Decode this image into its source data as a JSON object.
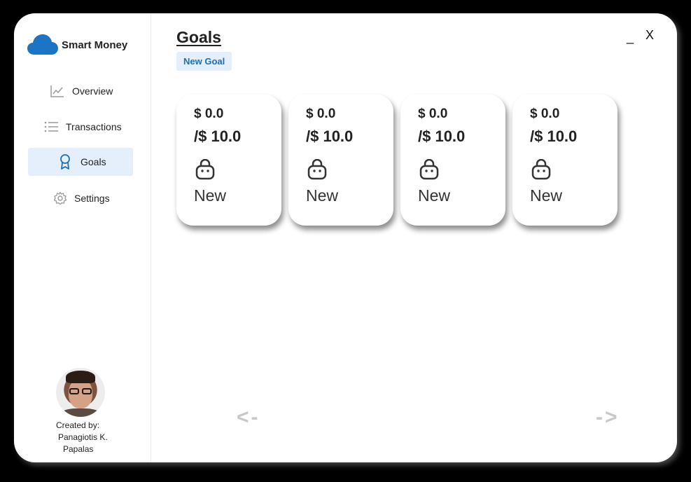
{
  "app": {
    "name": "Smart Money"
  },
  "window_controls": {
    "minimize_label": "_",
    "close_label": "X"
  },
  "sidebar": {
    "items": [
      {
        "label": "Overview",
        "icon": "chart-line-icon",
        "active": false
      },
      {
        "label": "Transactions",
        "icon": "list-icon",
        "active": false
      },
      {
        "label": "Goals",
        "icon": "award-icon",
        "active": true
      },
      {
        "label": "Settings",
        "icon": "gear-icon",
        "active": false
      }
    ],
    "credit": {
      "line1": "Created by:",
      "line2": "Panagiotis K.",
      "line3": "Papalas"
    }
  },
  "main": {
    "title": "Goals",
    "new_goal_label": "New Goal",
    "goals": [
      {
        "current": "$ 0.0",
        "target": "/$ 10.0",
        "icon": "shopping-bag-icon",
        "name": "New"
      },
      {
        "current": "$ 0.0",
        "target": "/$ 10.0",
        "icon": "shopping-bag-icon",
        "name": "New"
      },
      {
        "current": "$ 0.0",
        "target": "/$ 10.0",
        "icon": "shopping-bag-icon",
        "name": "New"
      },
      {
        "current": "$ 0.0",
        "target": "/$ 10.0",
        "icon": "shopping-bag-icon",
        "name": "New"
      }
    ],
    "pager": {
      "prev_label": "<-",
      "next_label": "->"
    }
  },
  "colors": {
    "accent": "#1c6fb5",
    "active_bg": "#e4effb",
    "arrow": "#c8c8c8"
  }
}
